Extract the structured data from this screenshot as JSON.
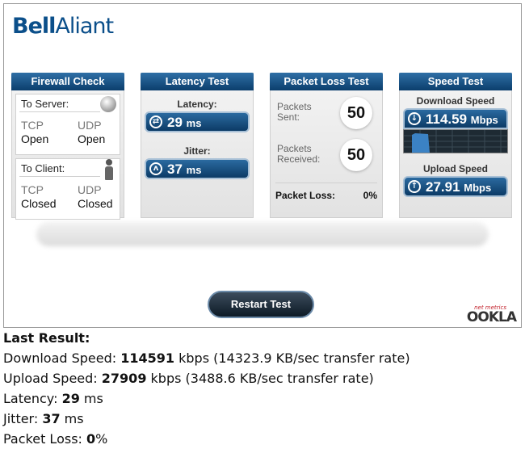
{
  "brand": {
    "bold": "Bell",
    "rest": "Aliant"
  },
  "firewall": {
    "title": "Firewall Check",
    "server": {
      "label": "To Server:",
      "tcp_label": "TCP",
      "tcp_value": "Open",
      "udp_label": "UDP",
      "udp_value": "Open",
      "icon": "globe-icon"
    },
    "client": {
      "label": "To Client:",
      "tcp_label": "TCP",
      "tcp_value": "Closed",
      "udp_label": "UDP",
      "udp_value": "Closed",
      "icon": "person-icon"
    }
  },
  "latency": {
    "title": "Latency Test",
    "latency_label": "Latency:",
    "latency_value": "29",
    "latency_unit": "ms",
    "jitter_label": "Jitter:",
    "jitter_value": "37",
    "jitter_unit": "ms"
  },
  "packet_loss": {
    "title": "Packet Loss Test",
    "sent_label_1": "Packets",
    "sent_label_2": "Sent:",
    "sent_value": "50",
    "received_label_1": "Packets",
    "received_label_2": "Received:",
    "received_value": "50",
    "loss_label": "Packet Loss:",
    "loss_value": "0%"
  },
  "speed": {
    "title": "Speed Test",
    "download_label": "Download Speed",
    "download_value": "114.59",
    "download_unit": "Mbps",
    "upload_label": "Upload Speed",
    "upload_value": "27.91",
    "upload_unit": "Mbps"
  },
  "restart_label": "Restart Test",
  "ookla": {
    "tag": "net metrics",
    "name": "OOKLA"
  },
  "result": {
    "heading": "Last Result:",
    "download_prefix": "Download Speed: ",
    "download_kbps": "114591",
    "download_suffix": " kbps (14323.9 KB/sec transfer rate)",
    "upload_prefix": "Upload Speed: ",
    "upload_kbps": "27909",
    "upload_suffix": " kbps (3488.6 KB/sec transfer rate)",
    "latency_prefix": "Latency: ",
    "latency_value": "29",
    "latency_suffix": " ms",
    "jitter_prefix": "Jitter: ",
    "jitter_value": "37",
    "jitter_suffix": " ms",
    "loss_prefix": "Packet Loss: ",
    "loss_value": "0",
    "loss_suffix": "%"
  }
}
